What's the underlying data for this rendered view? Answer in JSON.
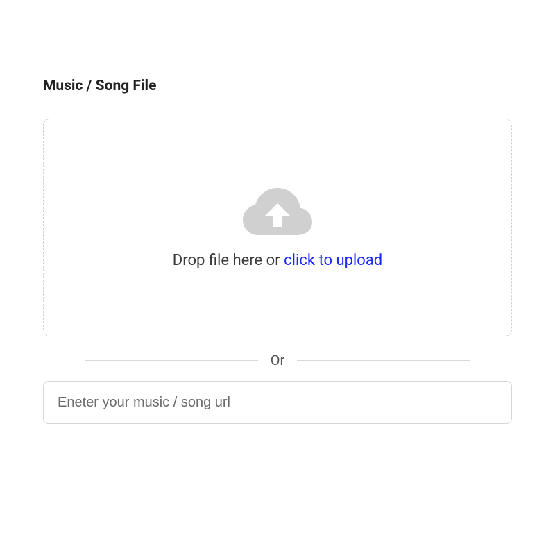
{
  "section": {
    "title": "Music / Song File"
  },
  "dropzone": {
    "icon_name": "cloud-upload-icon",
    "prompt_prefix": "Drop file here or ",
    "prompt_link": "click to upload"
  },
  "separator": {
    "label": "Or"
  },
  "url_field": {
    "placeholder": "Eneter your music / song url",
    "value": ""
  },
  "colors": {
    "link": "#1a28ff",
    "border_dashed": "#cfcfcf",
    "border_solid": "#d6d6d6",
    "icon": "#d0d0d0",
    "text": "#333333"
  }
}
